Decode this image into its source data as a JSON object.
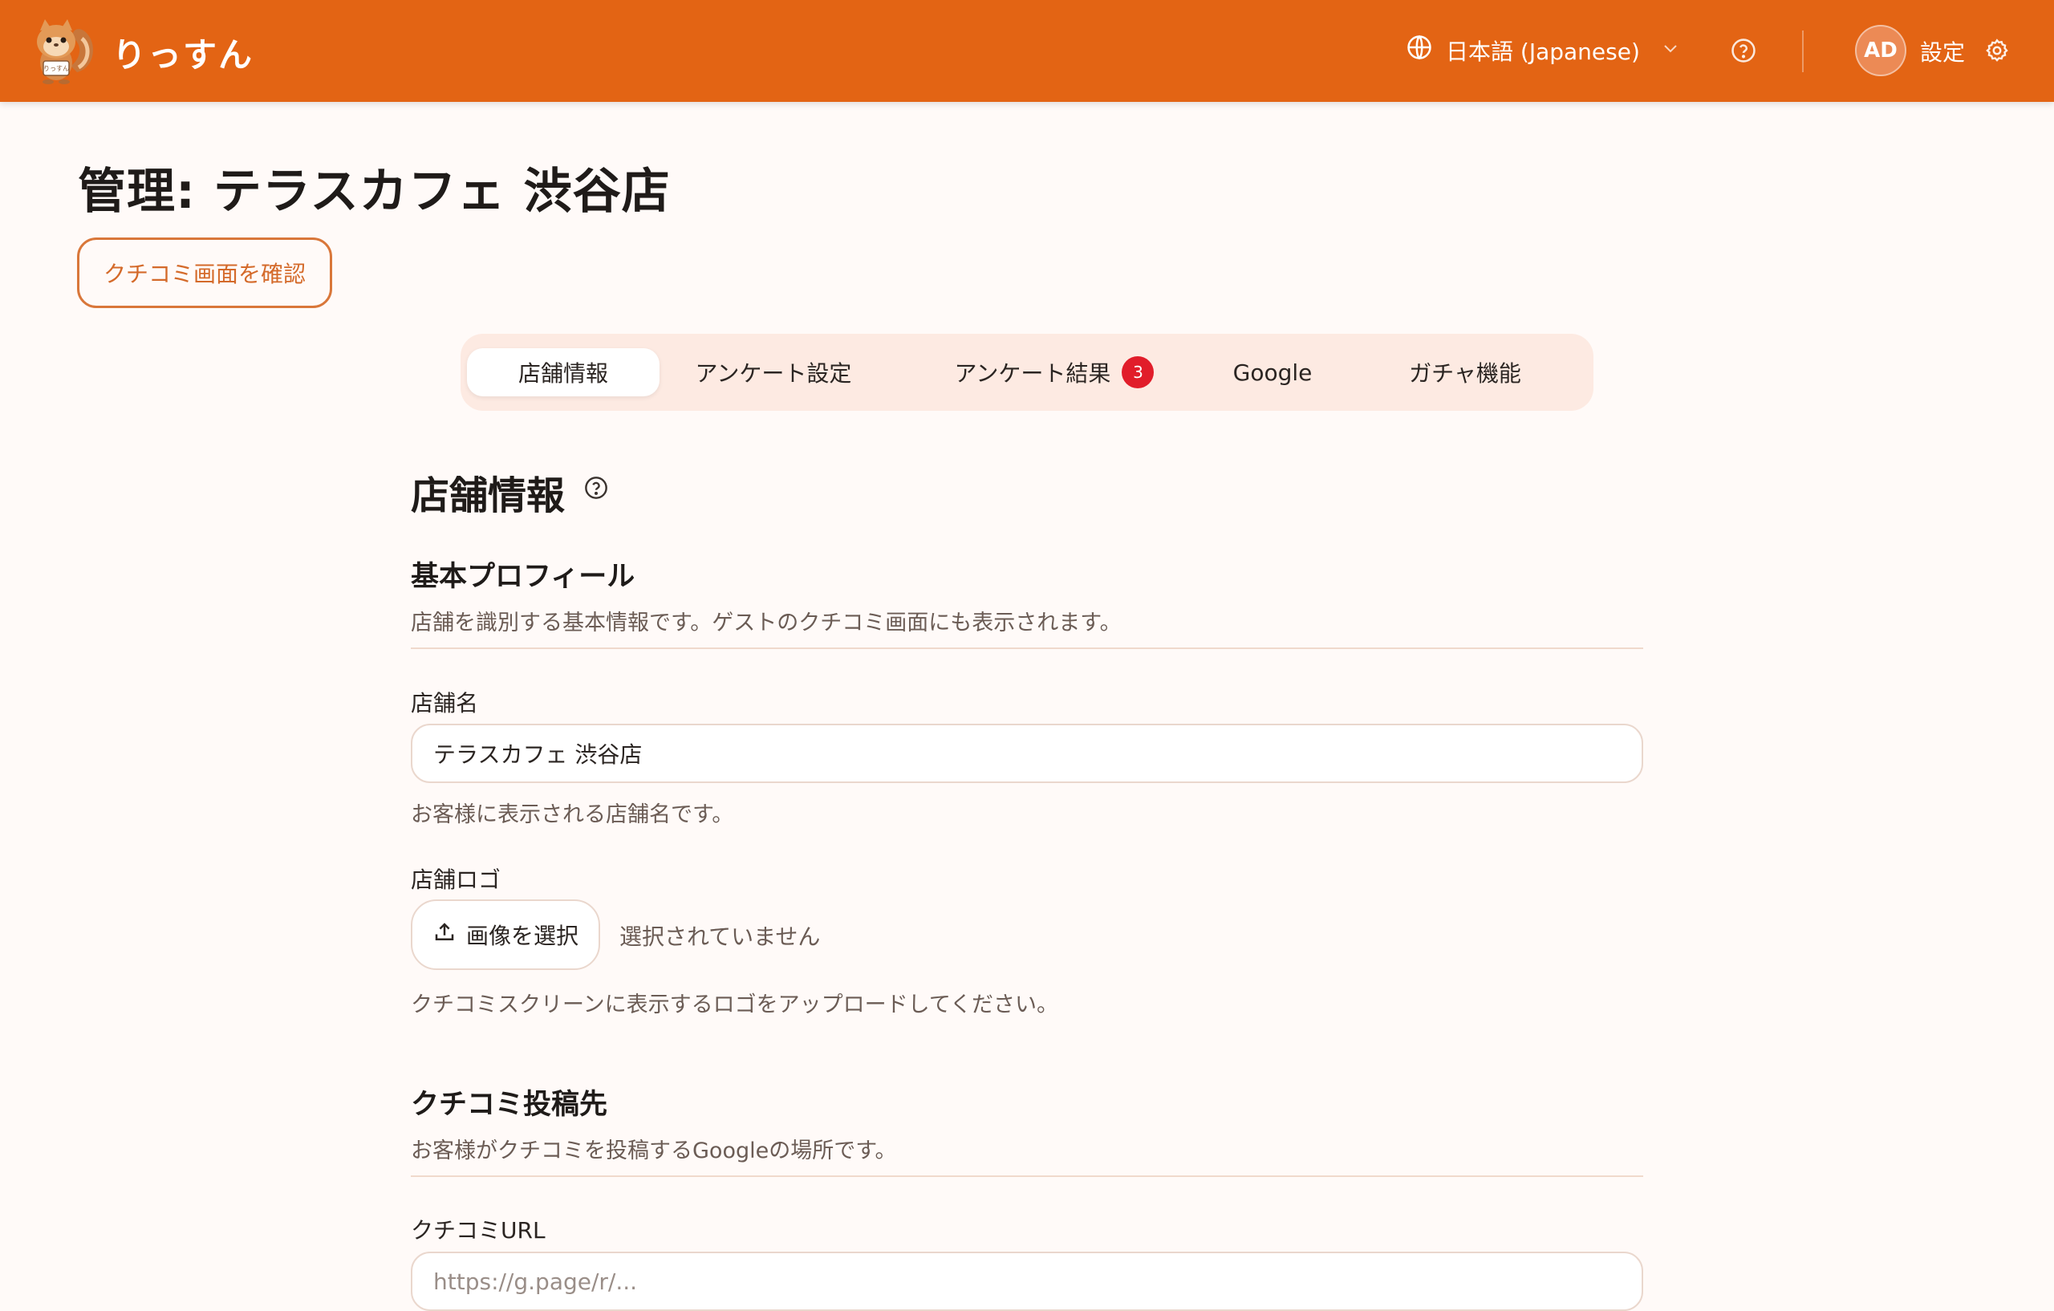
{
  "header": {
    "brand": "りっすん",
    "language": "日本語 (Japanese)",
    "avatar_initials": "AD",
    "settings_label": "設定"
  },
  "page": {
    "title": "管理: テラスカフェ 渋谷店",
    "review_button": "クチコミ画面を確認"
  },
  "tabs": [
    {
      "label": "店舗情報",
      "active": true
    },
    {
      "label": "アンケート設定",
      "active": false
    },
    {
      "label": "アンケート結果",
      "active": false,
      "badge": "3"
    },
    {
      "label": "Google",
      "active": false
    },
    {
      "label": "ガチャ機能",
      "active": false
    }
  ],
  "store_info": {
    "title": "店舗情報",
    "basic_profile": {
      "title": "基本プロフィール",
      "description": "店舗を識別する基本情報です。ゲストのクチコミ画面にも表示されます。",
      "store_name_label": "店舗名",
      "store_name_value": "テラスカフェ 渋谷店",
      "store_name_hint": "お客様に表示される店舗名です。",
      "logo_label": "店舗ロゴ",
      "select_image_button": "画像を選択",
      "no_file_text": "選択されていません",
      "logo_hint": "クチコミスクリーンに表示するロゴをアップロードしてください。"
    },
    "review_destination": {
      "title": "クチコミ投稿先",
      "description": "お客様がクチコミを投稿するGoogleの場所です。",
      "url_label": "クチコミURL",
      "url_placeholder": "https://g.page/r/..."
    }
  },
  "colors": {
    "header_bg": "#e36414",
    "accent": "#d9773a",
    "badge": "#e11d2a",
    "tab_bar_bg": "#fdeae2"
  }
}
